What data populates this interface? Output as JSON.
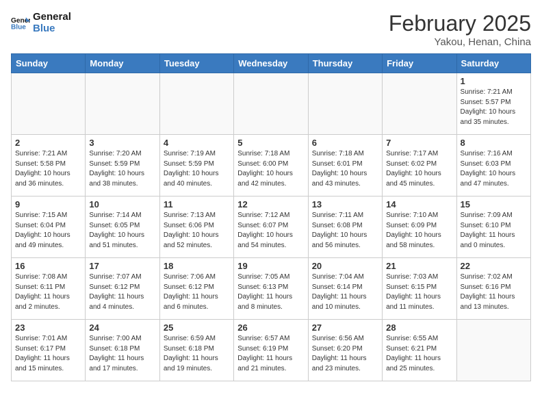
{
  "header": {
    "logo_line1": "General",
    "logo_line2": "Blue",
    "month": "February 2025",
    "location": "Yakou, Henan, China"
  },
  "days_of_week": [
    "Sunday",
    "Monday",
    "Tuesday",
    "Wednesday",
    "Thursday",
    "Friday",
    "Saturday"
  ],
  "weeks": [
    [
      {
        "day": "",
        "info": ""
      },
      {
        "day": "",
        "info": ""
      },
      {
        "day": "",
        "info": ""
      },
      {
        "day": "",
        "info": ""
      },
      {
        "day": "",
        "info": ""
      },
      {
        "day": "",
        "info": ""
      },
      {
        "day": "1",
        "info": "Sunrise: 7:21 AM\nSunset: 5:57 PM\nDaylight: 10 hours and 35 minutes."
      }
    ],
    [
      {
        "day": "2",
        "info": "Sunrise: 7:21 AM\nSunset: 5:58 PM\nDaylight: 10 hours and 36 minutes."
      },
      {
        "day": "3",
        "info": "Sunrise: 7:20 AM\nSunset: 5:59 PM\nDaylight: 10 hours and 38 minutes."
      },
      {
        "day": "4",
        "info": "Sunrise: 7:19 AM\nSunset: 5:59 PM\nDaylight: 10 hours and 40 minutes."
      },
      {
        "day": "5",
        "info": "Sunrise: 7:18 AM\nSunset: 6:00 PM\nDaylight: 10 hours and 42 minutes."
      },
      {
        "day": "6",
        "info": "Sunrise: 7:18 AM\nSunset: 6:01 PM\nDaylight: 10 hours and 43 minutes."
      },
      {
        "day": "7",
        "info": "Sunrise: 7:17 AM\nSunset: 6:02 PM\nDaylight: 10 hours and 45 minutes."
      },
      {
        "day": "8",
        "info": "Sunrise: 7:16 AM\nSunset: 6:03 PM\nDaylight: 10 hours and 47 minutes."
      }
    ],
    [
      {
        "day": "9",
        "info": "Sunrise: 7:15 AM\nSunset: 6:04 PM\nDaylight: 10 hours and 49 minutes."
      },
      {
        "day": "10",
        "info": "Sunrise: 7:14 AM\nSunset: 6:05 PM\nDaylight: 10 hours and 51 minutes."
      },
      {
        "day": "11",
        "info": "Sunrise: 7:13 AM\nSunset: 6:06 PM\nDaylight: 10 hours and 52 minutes."
      },
      {
        "day": "12",
        "info": "Sunrise: 7:12 AM\nSunset: 6:07 PM\nDaylight: 10 hours and 54 minutes."
      },
      {
        "day": "13",
        "info": "Sunrise: 7:11 AM\nSunset: 6:08 PM\nDaylight: 10 hours and 56 minutes."
      },
      {
        "day": "14",
        "info": "Sunrise: 7:10 AM\nSunset: 6:09 PM\nDaylight: 10 hours and 58 minutes."
      },
      {
        "day": "15",
        "info": "Sunrise: 7:09 AM\nSunset: 6:10 PM\nDaylight: 11 hours and 0 minutes."
      }
    ],
    [
      {
        "day": "16",
        "info": "Sunrise: 7:08 AM\nSunset: 6:11 PM\nDaylight: 11 hours and 2 minutes."
      },
      {
        "day": "17",
        "info": "Sunrise: 7:07 AM\nSunset: 6:12 PM\nDaylight: 11 hours and 4 minutes."
      },
      {
        "day": "18",
        "info": "Sunrise: 7:06 AM\nSunset: 6:12 PM\nDaylight: 11 hours and 6 minutes."
      },
      {
        "day": "19",
        "info": "Sunrise: 7:05 AM\nSunset: 6:13 PM\nDaylight: 11 hours and 8 minutes."
      },
      {
        "day": "20",
        "info": "Sunrise: 7:04 AM\nSunset: 6:14 PM\nDaylight: 11 hours and 10 minutes."
      },
      {
        "day": "21",
        "info": "Sunrise: 7:03 AM\nSunset: 6:15 PM\nDaylight: 11 hours and 11 minutes."
      },
      {
        "day": "22",
        "info": "Sunrise: 7:02 AM\nSunset: 6:16 PM\nDaylight: 11 hours and 13 minutes."
      }
    ],
    [
      {
        "day": "23",
        "info": "Sunrise: 7:01 AM\nSunset: 6:17 PM\nDaylight: 11 hours and 15 minutes."
      },
      {
        "day": "24",
        "info": "Sunrise: 7:00 AM\nSunset: 6:18 PM\nDaylight: 11 hours and 17 minutes."
      },
      {
        "day": "25",
        "info": "Sunrise: 6:59 AM\nSunset: 6:18 PM\nDaylight: 11 hours and 19 minutes."
      },
      {
        "day": "26",
        "info": "Sunrise: 6:57 AM\nSunset: 6:19 PM\nDaylight: 11 hours and 21 minutes."
      },
      {
        "day": "27",
        "info": "Sunrise: 6:56 AM\nSunset: 6:20 PM\nDaylight: 11 hours and 23 minutes."
      },
      {
        "day": "28",
        "info": "Sunrise: 6:55 AM\nSunset: 6:21 PM\nDaylight: 11 hours and 25 minutes."
      },
      {
        "day": "",
        "info": ""
      }
    ]
  ]
}
